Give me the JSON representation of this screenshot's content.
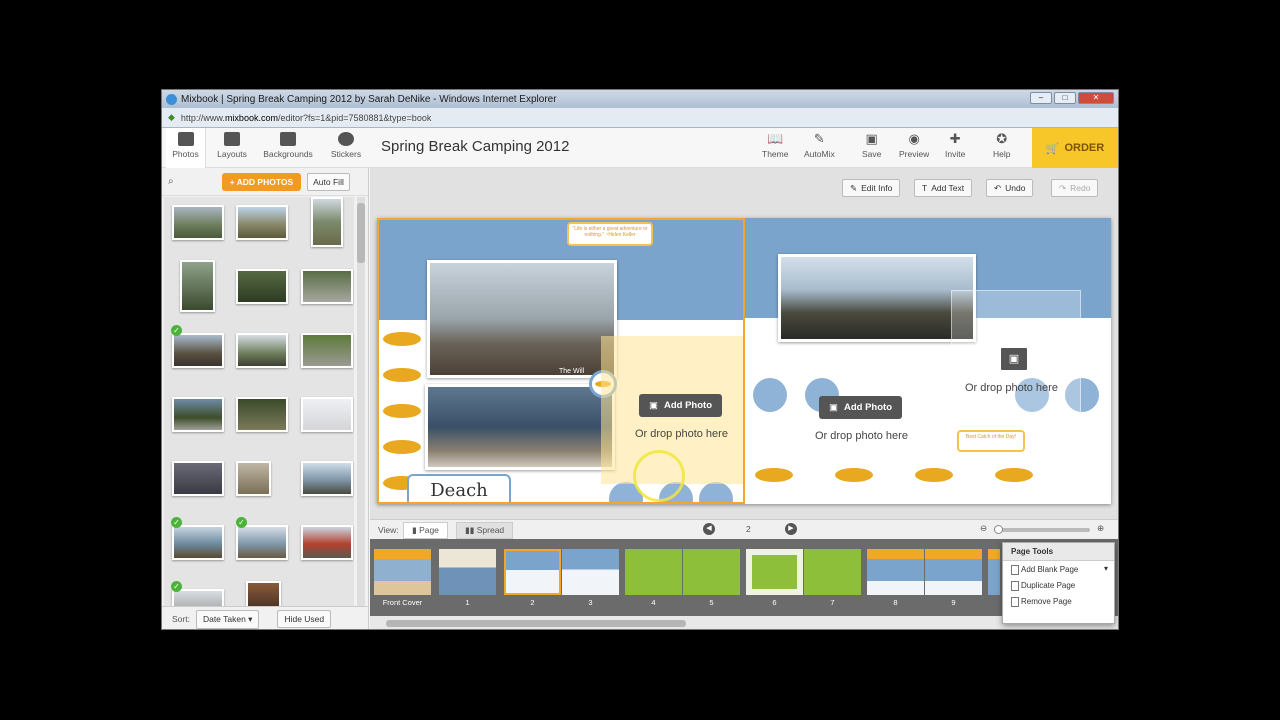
{
  "window": {
    "title": "Mixbook | Spring Break Camping 2012 by Sarah DeNike - Windows Internet Explorer",
    "url_prefix": "http://www.",
    "url_domain": "mixbook.com",
    "url_rest": "/editor?fs=1&pid=7580881&type=book"
  },
  "left_tabs": [
    "Photos",
    "Layouts",
    "Backgrounds",
    "Stickers"
  ],
  "book_title": "Spring Break Camping 2012",
  "right_tools": [
    "Theme",
    "AutoMix",
    "Save",
    "Preview",
    "Invite",
    "Help"
  ],
  "order_label": "ORDER",
  "photos_panel": {
    "add_photos": "+ ADD PHOTOS",
    "auto_fill": "Auto Fill",
    "sort_label": "Sort:",
    "sort_value": "Date Taken",
    "hide_used": "Hide Used"
  },
  "canvas_tools": [
    "Edit Info",
    "Add Text",
    "Undo",
    "Redo"
  ],
  "spread": {
    "quote": "\"Life is either a great adventure or nothing.\" ~Helen Keller",
    "caption": "The Will",
    "beach_label": "Deach",
    "add_photo": "Add Photo",
    "drop_text": "Or drop photo here",
    "best_catch": "Best Catch of the Day!"
  },
  "viewbar": {
    "view_label": "View:",
    "page_label": "Page",
    "spread_label": "Spread",
    "page_number": "2"
  },
  "filmstrip": [
    "Front Cover",
    "1",
    "2",
    "3",
    "4",
    "5",
    "6",
    "7",
    "8",
    "9"
  ],
  "page_tools": {
    "header": "Page Tools",
    "items": [
      "Add Blank Page",
      "Duplicate Page",
      "Remove Page"
    ]
  }
}
